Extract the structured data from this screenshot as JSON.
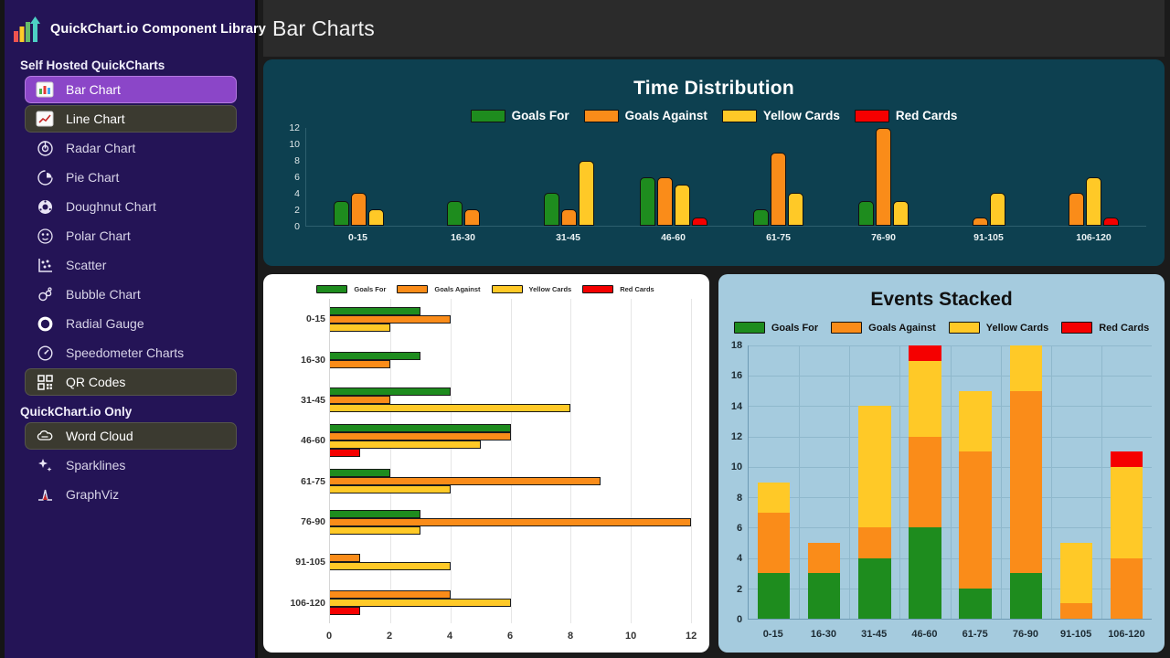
{
  "header": {
    "title": "Bar Charts"
  },
  "sidebar": {
    "brand": "QuickChart.io Component Library",
    "logo_icon": "bar-chart-growth-logo",
    "sections": [
      {
        "label": "Self Hosted QuickCharts",
        "items": [
          {
            "label": "Bar Chart",
            "icon": "bar-chart-icon",
            "state": "active"
          },
          {
            "label": "Line Chart",
            "icon": "line-chart-icon",
            "state": "hover"
          },
          {
            "label": "Radar Chart",
            "icon": "radar-chart-icon",
            "state": "normal"
          },
          {
            "label": "Pie Chart",
            "icon": "pie-chart-icon",
            "state": "normal"
          },
          {
            "label": "Doughnut Chart",
            "icon": "doughnut-icon",
            "state": "normal"
          },
          {
            "label": "Polar Chart",
            "icon": "polar-chart-icon",
            "state": "normal"
          },
          {
            "label": "Scatter",
            "icon": "scatter-icon",
            "state": "normal"
          },
          {
            "label": "Bubble Chart",
            "icon": "bubble-chart-icon",
            "state": "normal"
          },
          {
            "label": "Radial Gauge",
            "icon": "radial-gauge-icon",
            "state": "normal"
          },
          {
            "label": "Speedometer Charts",
            "icon": "speedometer-icon",
            "state": "normal"
          },
          {
            "label": "QR Codes",
            "icon": "qr-code-icon",
            "state": "hover"
          }
        ]
      },
      {
        "label": "QuickChart.io Only",
        "items": [
          {
            "label": "Word Cloud",
            "icon": "cloud-icon",
            "state": "hover"
          },
          {
            "label": "Sparklines",
            "icon": "sparkline-icon",
            "state": "normal"
          },
          {
            "label": "GraphViz",
            "icon": "graphviz-icon",
            "state": "normal"
          }
        ]
      }
    ]
  },
  "colors": {
    "goals_for": "#1e8c1e",
    "goals_against": "#fa8c19",
    "yellow_cards": "#ffc927",
    "red_cards": "#f50000",
    "panel_top_bg": "#0d4050",
    "panel_stack_bg": "#a5cbde",
    "sidebar_bg": "#241456",
    "accent": "#8b46c8"
  },
  "chart_data": [
    {
      "type": "bar",
      "id": "time-distribution",
      "title": "Time Distribution",
      "orientation": "vertical",
      "grouped": true,
      "grid": false,
      "legend": [
        "Goals For",
        "Goals Against",
        "Yellow Cards",
        "Red Cards"
      ],
      "legend_position": "top",
      "categories": [
        "0-15",
        "16-30",
        "31-45",
        "46-60",
        "61-75",
        "76-90",
        "91-105",
        "106-120"
      ],
      "xlabel": "",
      "ylabel": "",
      "ylim": [
        0,
        12
      ],
      "yticks": [
        0,
        2,
        4,
        6,
        8,
        10,
        12
      ],
      "series": [
        {
          "name": "Goals For",
          "color": "#1e8c1e",
          "values": [
            3,
            3,
            4,
            6,
            2,
            3,
            0,
            0
          ]
        },
        {
          "name": "Goals Against",
          "color": "#fa8c19",
          "values": [
            4,
            2,
            2,
            6,
            9,
            12,
            1,
            4
          ]
        },
        {
          "name": "Yellow Cards",
          "color": "#ffc927",
          "values": [
            2,
            0,
            8,
            5,
            4,
            3,
            4,
            6
          ]
        },
        {
          "name": "Red Cards",
          "color": "#f50000",
          "values": [
            0,
            0,
            0,
            1,
            0,
            0,
            0,
            1
          ]
        }
      ]
    },
    {
      "type": "bar",
      "id": "horizontal-bars",
      "title": "",
      "orientation": "horizontal",
      "grouped": true,
      "grid": true,
      "legend": [
        "Goals For",
        "Goals Against",
        "Yellow Cards",
        "Red Cards"
      ],
      "legend_position": "top",
      "categories": [
        "0-15",
        "16-30",
        "31-45",
        "46-60",
        "61-75",
        "76-90",
        "91-105",
        "106-120"
      ],
      "xlabel": "",
      "ylabel": "",
      "xlim": [
        0,
        12
      ],
      "xticks": [
        0,
        2,
        4,
        6,
        8,
        10,
        12
      ],
      "series": [
        {
          "name": "Goals For",
          "color": "#1e8c1e",
          "values": [
            3,
            3,
            4,
            6,
            2,
            3,
            0,
            0
          ]
        },
        {
          "name": "Goals Against",
          "color": "#fa8c19",
          "values": [
            4,
            2,
            2,
            6,
            9,
            12,
            1,
            4
          ]
        },
        {
          "name": "Yellow Cards",
          "color": "#ffc927",
          "values": [
            2,
            0,
            8,
            5,
            4,
            3,
            4,
            6
          ]
        },
        {
          "name": "Red Cards",
          "color": "#f50000",
          "values": [
            0,
            0,
            0,
            1,
            0,
            0,
            0,
            1
          ]
        }
      ]
    },
    {
      "type": "bar",
      "id": "events-stacked",
      "title": "Events Stacked",
      "orientation": "vertical",
      "stacked": true,
      "grid": true,
      "legend": [
        "Goals For",
        "Goals Against",
        "Yellow Cards",
        "Red Cards"
      ],
      "legend_position": "top",
      "categories": [
        "0-15",
        "16-30",
        "31-45",
        "46-60",
        "61-75",
        "76-90",
        "91-105",
        "106-120"
      ],
      "xlabel": "",
      "ylabel": "",
      "ylim": [
        0,
        18
      ],
      "yticks": [
        0,
        2,
        4,
        6,
        8,
        10,
        12,
        14,
        16,
        18
      ],
      "series": [
        {
          "name": "Goals For",
          "color": "#1e8c1e",
          "values": [
            3,
            3,
            4,
            6,
            2,
            3,
            0,
            0
          ]
        },
        {
          "name": "Goals Against",
          "color": "#fa8c19",
          "values": [
            4,
            2,
            2,
            6,
            9,
            12,
            1,
            4
          ]
        },
        {
          "name": "Yellow Cards",
          "color": "#ffc927",
          "values": [
            2,
            0,
            8,
            5,
            4,
            3,
            4,
            6
          ]
        },
        {
          "name": "Red Cards",
          "color": "#f50000",
          "values": [
            0,
            0,
            0,
            1,
            0,
            0,
            0,
            1
          ]
        }
      ],
      "totals": [
        9,
        5,
        14,
        18,
        15,
        18,
        5,
        11
      ]
    }
  ]
}
